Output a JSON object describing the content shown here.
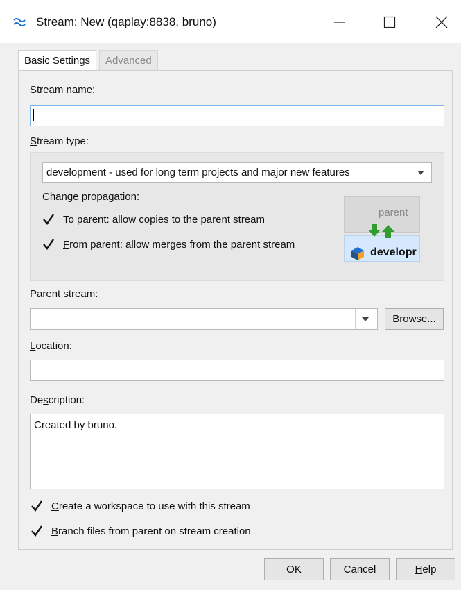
{
  "window": {
    "title": "Stream: New (qaplay:8838,  bruno)",
    "icon": "stream-icon",
    "controls": [
      "minimize-icon",
      "maximize-icon",
      "close-icon"
    ]
  },
  "tabs": [
    {
      "label": "Basic Settings",
      "active": true
    },
    {
      "label": "Advanced",
      "active": false
    }
  ],
  "stream_name": {
    "label_pre": "Stream ",
    "label_key": "n",
    "label_post": "ame:",
    "value": ""
  },
  "stream_type": {
    "label_key": "S",
    "label_post": "tream type:",
    "selected": "development - used for long term projects and major new features",
    "propagation_label": "Change propagation:",
    "to_parent": {
      "key": "T",
      "rest": "o parent: allow copies to the parent stream",
      "checked": true
    },
    "from_parent": {
      "key": "F",
      "rest": "rom parent: allow merges from the parent stream",
      "checked": true
    },
    "diagram": {
      "parent_label": "parent",
      "child_label": "developr"
    }
  },
  "parent_stream": {
    "label_key": "P",
    "label_post": "arent stream:",
    "value": "",
    "browse_key": "B",
    "browse_rest": "rowse..."
  },
  "location": {
    "label_key": "L",
    "label_post": "ocation:",
    "value": ""
  },
  "description": {
    "label_pre": "De",
    "label_key": "s",
    "label_post": "cription:",
    "value": "Created by bruno."
  },
  "options": [
    {
      "key": "C",
      "rest": "reate a workspace to use with this stream",
      "checked": true
    },
    {
      "key": "B",
      "rest": "ranch files from parent on stream creation",
      "checked": true
    }
  ],
  "buttons": {
    "ok": "OK",
    "cancel": "Cancel",
    "help_key": "H",
    "help_rest": "elp"
  },
  "colors": {
    "accent": "#1f6fd0",
    "arrow_green": "#2f9e2f",
    "child_bg": "#d6e8fb",
    "focus_border": "#7eb4ea"
  }
}
